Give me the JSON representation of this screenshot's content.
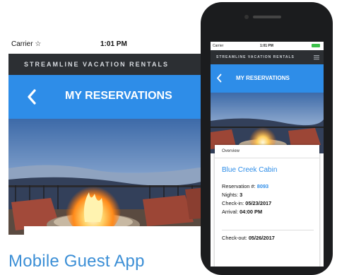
{
  "large_screen": {
    "status": {
      "carrier": "Carrier ☆",
      "time": "1:01 PM"
    },
    "brand": "STREAMLINE VACATION RENTALS",
    "title": "MY RESERVATIONS"
  },
  "caption": "Mobile Guest App",
  "phone_screen": {
    "status": {
      "carrier": "Carrier",
      "time": "1:01 PM"
    },
    "brand": "STREAMLINE VACATION RENTALS",
    "title": "MY RESERVATIONS",
    "tab": "Overview",
    "property": "Blue Creek Cabin",
    "reservation_label": "Reservation #:",
    "reservation_value": "8093",
    "nights_label": "Nights:",
    "nights_value": "3",
    "checkin_label": "Check-in:",
    "checkin_value": "05/23/2017",
    "arrival_label": "Arrival:",
    "arrival_value": "04:00 PM",
    "checkout_label": "Check-out:",
    "checkout_value": "05/26/2017"
  },
  "icons": {
    "back": "chevron-left-icon",
    "menu": "hamburger-menu-icon",
    "wifi": "wifi-icon",
    "battery": "battery-icon"
  },
  "colors": {
    "header_blue": "#2e8de8",
    "brand_bar": "#2c2f33",
    "caption": "#3c8fd6",
    "link": "#2e8de8",
    "battery": "#3cc14a"
  }
}
